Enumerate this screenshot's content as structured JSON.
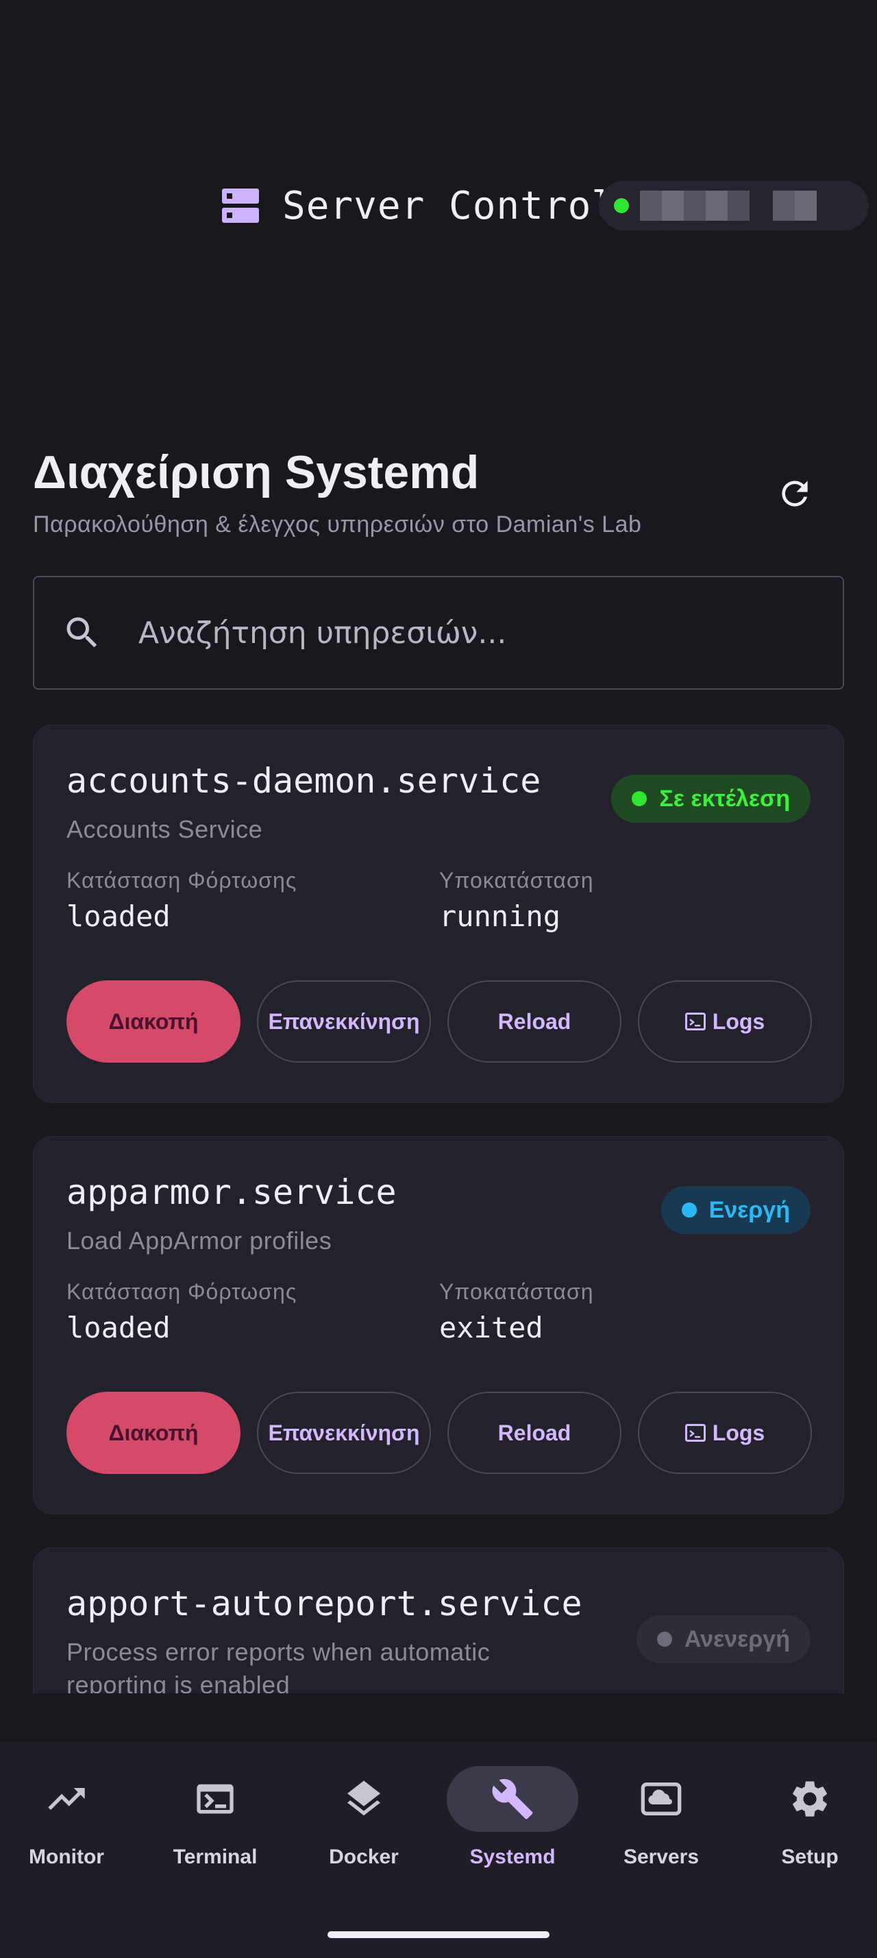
{
  "app": {
    "title": "Server Control",
    "connection_status_color": "#2fe52f",
    "connection_label_redacted": true
  },
  "header": {
    "title": "Διαχείριση Systemd",
    "subtitle": "Παρακολούθηση & έλεγχος υπηρεσιών στο Damian's Lab",
    "refresh_icon": "refresh-icon"
  },
  "search": {
    "placeholder": "Αναζήτηση υπηρεσιών...",
    "value": ""
  },
  "labels": {
    "load_state": "Κατάσταση Φόρτωσης",
    "sub_state": "Υποκατάσταση"
  },
  "services": [
    {
      "name": "accounts-daemon.service",
      "description": "Accounts Service",
      "status": "Σε εκτέλεση",
      "status_kind": "running",
      "load_state": "loaded",
      "sub_state": "running",
      "actions": {
        "stop": "Διακοπή",
        "restart": "Επανεκκίνηση",
        "reload": "Reload",
        "logs": "Logs"
      }
    },
    {
      "name": "apparmor.service",
      "description": "Load AppArmor profiles",
      "status": "Ενεργή",
      "status_kind": "active",
      "load_state": "loaded",
      "sub_state": "exited",
      "actions": {
        "stop": "Διακοπή",
        "restart": "Επανεκκίνηση",
        "reload": "Reload",
        "logs": "Logs"
      }
    },
    {
      "name": "apport-autoreport.service",
      "description": "Process error reports when automatic reporting is enabled",
      "status": "Ανενεργή",
      "status_kind": "inactive"
    }
  ],
  "colors": {
    "running": "#3cf03c",
    "active": "#2bb8f4",
    "inactive": "#6e6b78",
    "stop_button": "#d44a68",
    "accent": "#d4b8ff"
  },
  "nav": {
    "items": [
      {
        "label": "Monitor",
        "icon": "trending-up-icon"
      },
      {
        "label": "Terminal",
        "icon": "terminal-icon"
      },
      {
        "label": "Docker",
        "icon": "layers-icon"
      },
      {
        "label": "Systemd",
        "icon": "wrench-icon",
        "active": true
      },
      {
        "label": "Servers",
        "icon": "cloud-server-icon"
      },
      {
        "label": "Setup",
        "icon": "gear-icon"
      }
    ]
  }
}
